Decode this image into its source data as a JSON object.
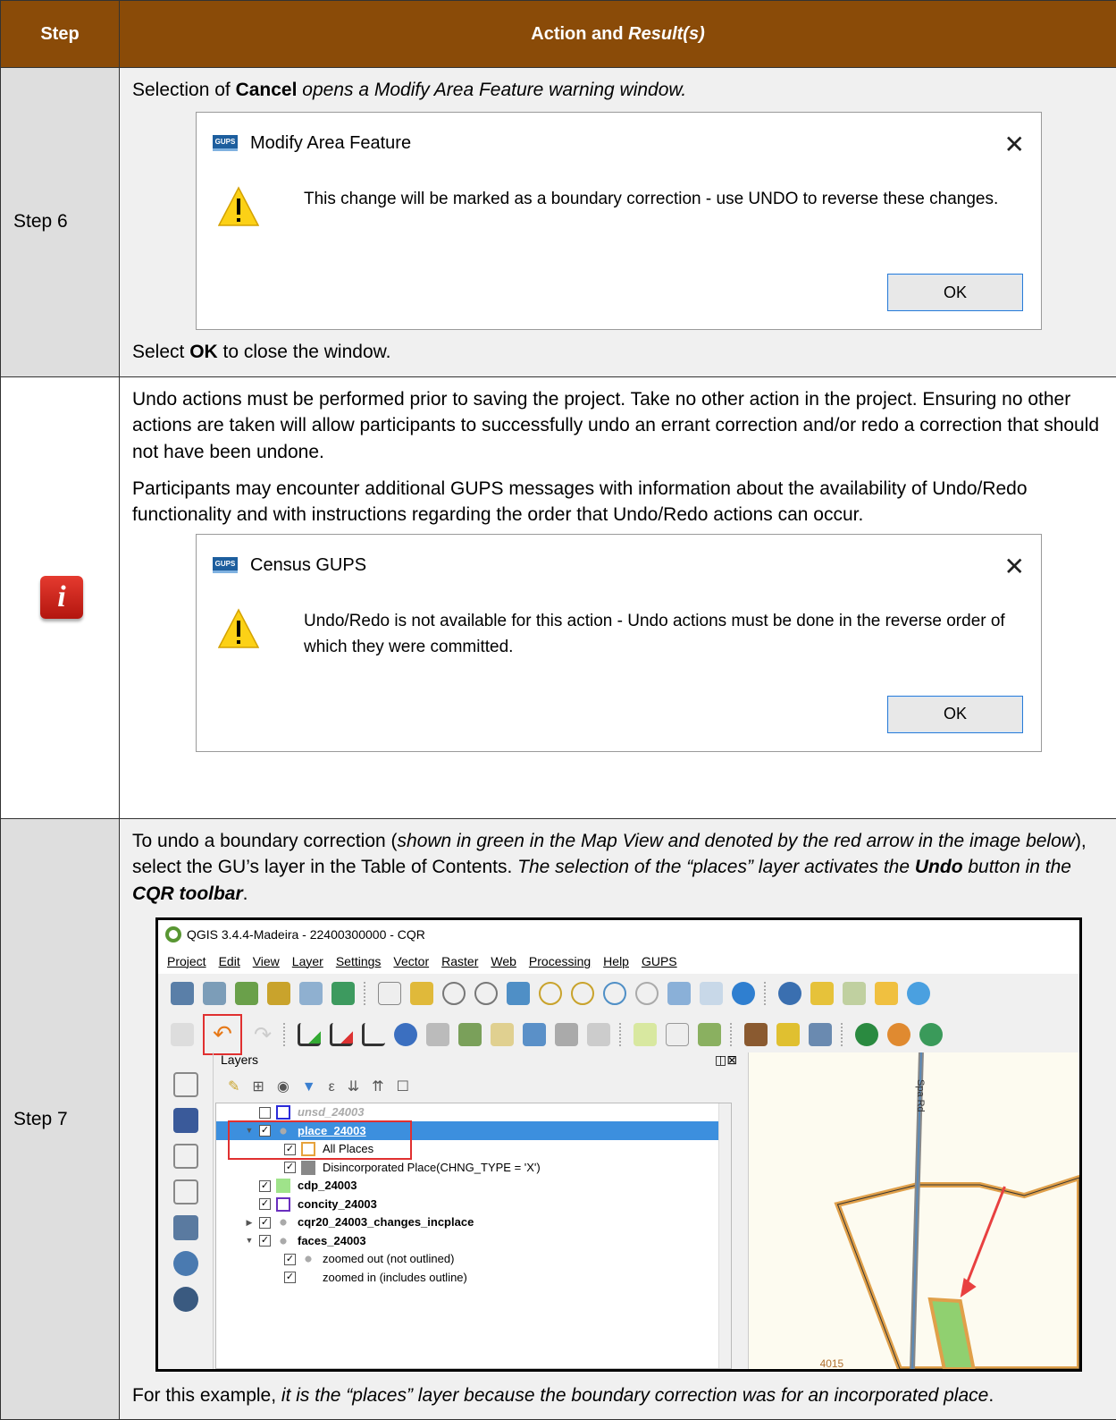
{
  "header": {
    "step": "Step",
    "action": "Action and",
    "result": "Result(s)"
  },
  "row1": {
    "step": "Step 6",
    "intro_pre": "Selection of ",
    "intro_bold": "Cancel",
    "intro_italic": " opens a Modify Area Feature warning window.",
    "dialog": {
      "title": "Modify Area Feature",
      "logo_text": "GUPS",
      "close": "✕",
      "message": "This change will be marked as a boundary correction - use UNDO to reverse these changes.",
      "ok": "OK"
    },
    "outro_pre": "Select ",
    "outro_bold": "OK",
    "outro_post": " to close the window."
  },
  "row2": {
    "icon": "i",
    "p1": "Undo actions must be performed prior to saving the project. Take no other action in the project. Ensuring no other actions are taken will allow participants to successfully undo an errant correction and/or redo a correction that should not have been undone.",
    "p2": "Participants may encounter additional GUPS messages with information about the availability of Undo/Redo functionality and with instructions regarding the order that Undo/Redo actions can occur.",
    "dialog": {
      "title": "Census GUPS",
      "logo_text": "GUPS",
      "close": "✕",
      "message": "Undo/Redo is not available for this action - Undo actions must be done in the reverse order of which they were committed.",
      "ok": "OK"
    }
  },
  "row3": {
    "step": "Step 7",
    "p_a": "To undo a boundary correction (",
    "p_b": "shown in green in the Map View and denoted by the red arrow in the image below",
    "p_c": "), select the GU’s layer in the Table of Contents. ",
    "p_d": "The selection of the “places” layer activates the ",
    "p_e": "Undo",
    "p_f": " button in the ",
    "p_g": "CQR toolbar",
    "p_h": ".",
    "foot_a": "For this example, ",
    "foot_b": "it is the “places” layer because the boundary correction was for an incorporated place",
    "foot_c": ".",
    "qgis": {
      "title": "QGIS 3.4.4-Madeira - 22400300000 - CQR",
      "menu": [
        "Project",
        "Edit",
        "View",
        "Layer",
        "Settings",
        "Vector",
        "Raster",
        "Web",
        "Processing",
        "Help",
        "GUPS"
      ],
      "panel_title": "Layers",
      "panel_buttons": "◫⊠",
      "map_label": "Spa Rd",
      "map_num": "4015",
      "layers": [
        {
          "name": "unsd_24003",
          "checked": "",
          "color": "#2b2bd9",
          "indent": 1,
          "expand": ""
        },
        {
          "name": "place_24003",
          "checked": "✓",
          "color": "",
          "indent": 1,
          "expand": "▼",
          "selected": true
        },
        {
          "name": "All Places",
          "checked": "✓",
          "color": "#e6a23c",
          "indent": 2,
          "expand": ""
        },
        {
          "name": "Disincorporated Place(CHNG_TYPE = 'X')",
          "checked": "✓",
          "color": "#888888",
          "indent": 2,
          "expand": ""
        },
        {
          "name": "cdp_24003",
          "checked": "✓",
          "color": "#9fe38a",
          "indent": 1,
          "expand": ""
        },
        {
          "name": "concity_24003",
          "checked": "✓",
          "color": "#6a2fbf",
          "indent": 1,
          "expand": ""
        },
        {
          "name": "cqr20_24003_changes_incplace",
          "checked": "✓",
          "color": "",
          "indent": 1,
          "expand": "▶"
        },
        {
          "name": "faces_24003",
          "checked": "✓",
          "color": "",
          "indent": 1,
          "expand": "▼"
        },
        {
          "name": "zoomed out (not outlined)",
          "checked": "✓",
          "color": "",
          "indent": 2,
          "expand": ""
        },
        {
          "name": "zoomed in (includes outline)",
          "checked": "✓",
          "color": "#ffffff",
          "indent": 2,
          "expand": ""
        }
      ]
    }
  }
}
